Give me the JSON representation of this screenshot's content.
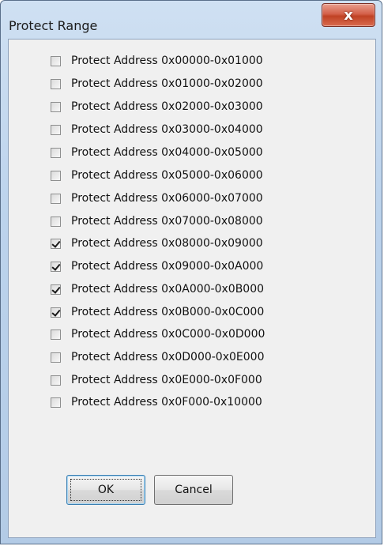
{
  "window": {
    "title": "Protect Range",
    "close_label": "x"
  },
  "checkboxes": [
    {
      "label": "Protect Address 0x00000-0x01000",
      "checked": false
    },
    {
      "label": "Protect Address 0x01000-0x02000",
      "checked": false
    },
    {
      "label": "Protect Address 0x02000-0x03000",
      "checked": false
    },
    {
      "label": "Protect Address 0x03000-0x04000",
      "checked": false
    },
    {
      "label": "Protect Address 0x04000-0x05000",
      "checked": false
    },
    {
      "label": "Protect Address 0x05000-0x06000",
      "checked": false
    },
    {
      "label": "Protect Address 0x06000-0x07000",
      "checked": false
    },
    {
      "label": "Protect Address 0x07000-0x08000",
      "checked": false
    },
    {
      "label": "Protect Address 0x08000-0x09000",
      "checked": true
    },
    {
      "label": "Protect Address 0x09000-0x0A000",
      "checked": true
    },
    {
      "label": "Protect Address 0x0A000-0x0B000",
      "checked": true
    },
    {
      "label": "Protect Address 0x0B000-0x0C000",
      "checked": true
    },
    {
      "label": "Protect Address 0x0C000-0x0D000",
      "checked": false
    },
    {
      "label": "Protect Address 0x0D000-0x0E000",
      "checked": false
    },
    {
      "label": "Protect Address 0x0E000-0x0F000",
      "checked": false
    },
    {
      "label": "Protect Address 0x0F000-0x10000",
      "checked": false
    }
  ],
  "buttons": {
    "ok_label": "OK",
    "cancel_label": "Cancel"
  },
  "colors": {
    "close_button": "#c94a2e",
    "title_bar": "#bcd3ec",
    "client_bg": "#f0f0f0"
  }
}
